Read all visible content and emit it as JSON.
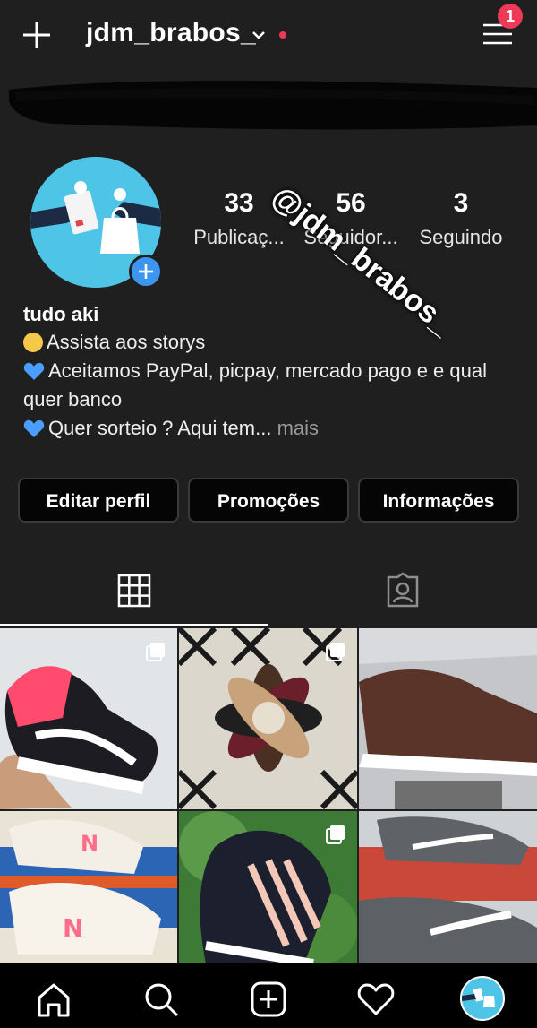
{
  "header": {
    "username": "jdm_brabos_",
    "notification_count": "1"
  },
  "watermark": "@jdm_brabos_",
  "stats": [
    {
      "value": "33",
      "label": "Publicaç..."
    },
    {
      "value": "56",
      "label": "Seguidor..."
    },
    {
      "value": "3",
      "label": "Seguindo"
    }
  ],
  "bio": {
    "name": "tudo aki",
    "line1": "Assista aos storys",
    "line2": "Aceitamos PayPal, picpay, mercado pago e e qual",
    "line3": "quer banco",
    "line4": "Quer sorteio ? Aqui tem...",
    "more": " mais"
  },
  "buttons": {
    "edit": "Editar perfil",
    "promo": "Promoções",
    "info": "Informações"
  },
  "icons": {
    "top_left": "plus-icon",
    "top_right": "menu-icon",
    "grid_tab": "grid-icon",
    "tagged_tab": "tagged-person-icon",
    "nav": [
      "home-icon",
      "search-icon",
      "new-post-icon",
      "heart-icon",
      "profile-avatar"
    ]
  },
  "colors": {
    "accent_red": "#ef3a57",
    "story_blue": "#3c96f0",
    "avatar_bg": "#4ec4e6",
    "background": "#1f1f1f"
  }
}
